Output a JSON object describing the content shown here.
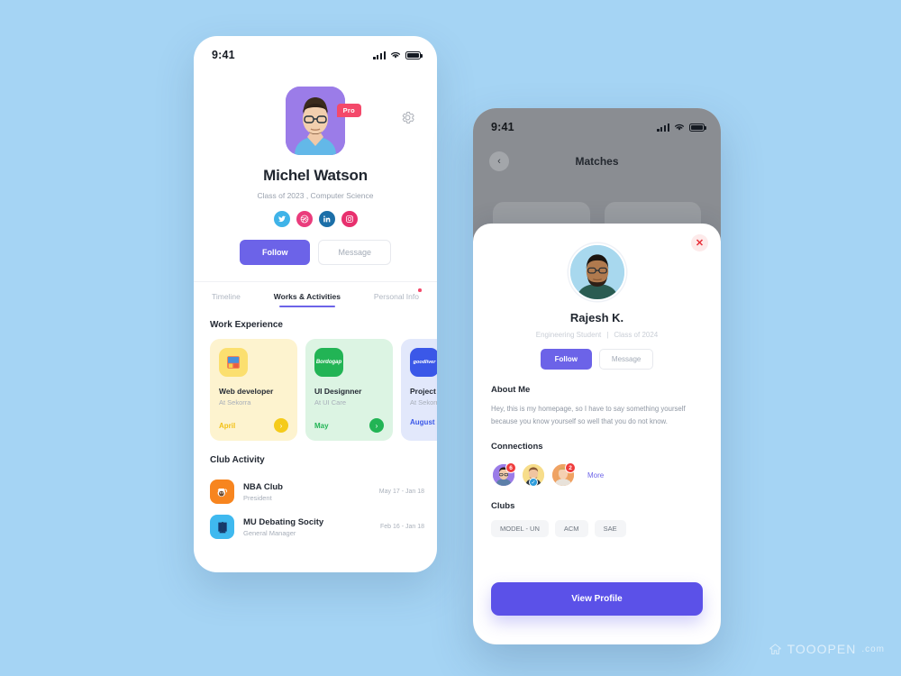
{
  "background_color": "#a5d4f4",
  "accent_color": "#6c63e8",
  "phone1": {
    "status_bar": {
      "time": "9:41",
      "signal_icon": "signal-bars-icon",
      "wifi_icon": "wifi-icon",
      "battery_icon": "battery-icon"
    },
    "settings_icon": "gear-icon",
    "avatar": "user-avatar-michel",
    "pro_badge": "Pro",
    "name": "Michel Watson",
    "subtitle": "Class of 2023 , Computer Science",
    "socials": [
      {
        "name": "twitter-icon",
        "color": "#3fb3e8"
      },
      {
        "name": "dribbble-icon",
        "color": "#ea3c7c"
      },
      {
        "name": "linkedin-icon",
        "color": "#1c6fa8"
      },
      {
        "name": "instagram-icon",
        "color": "#e8306e"
      }
    ],
    "follow_label": "Follow",
    "message_label": "Message",
    "tabs": [
      {
        "label": "Timeline",
        "active": false,
        "dot": false
      },
      {
        "label": "Works & Activities",
        "active": true,
        "dot": false
      },
      {
        "label": "Personal Info",
        "active": false,
        "dot": true
      }
    ],
    "work_section_title": "Work Experience",
    "work_cards": [
      {
        "title": "Web developer",
        "company": "At Sekorra",
        "month": "April",
        "bg": "#fdf3cf",
        "icon_bg": "#fbdf6f",
        "accent": "#f2c014",
        "logo_text": ""
      },
      {
        "title": "UI Designner",
        "company": "At UI Care",
        "month": "May",
        "bg": "#dcf4e3",
        "icon_bg": "#22b455",
        "accent": "#22b455",
        "logo_text": "Bordogap"
      },
      {
        "title": "Project Man",
        "company": "At Sekorra",
        "month": "August",
        "bg": "#e2e8fb",
        "icon_bg": "#3b58e8",
        "accent": "#3b58e8",
        "logo_text": "goodliver"
      }
    ],
    "club_section_title": "Club Activity",
    "clubs": [
      {
        "name": "NBA Club",
        "role": "President",
        "date": "May 17 - Jan 18",
        "icon_bg": "#f7851f",
        "icon": "mascot-icon"
      },
      {
        "name": "MU Debating Socity",
        "role": "General Manager",
        "date": "Feb 16 - Jan 18",
        "icon_bg": "#3fb9ef",
        "icon": "book-icon"
      }
    ]
  },
  "phone2": {
    "status_bar": {
      "time": "9:41",
      "signal_icon": "signal-bars-icon",
      "wifi_icon": "wifi-icon",
      "battery_icon": "battery-icon"
    },
    "back_icon": "chevron-left-icon",
    "header_title": "Matches",
    "close_icon": "close-x-icon",
    "avatar": "user-avatar-rajesh",
    "name": "Rajesh K.",
    "subtitle_left": "Engineering Student",
    "subtitle_right": "Class of 2024",
    "follow_label": "Follow",
    "message_label": "Message",
    "about_title": "About Me",
    "about_text": "Hey, this is my homepage, so I have to say something yourself because you know yourself so well that you do not know.",
    "connections_title": "Connections",
    "connections": [
      {
        "name": "connection-avatar-1",
        "badge": "6",
        "verified": false,
        "bg": "#9b7ce8"
      },
      {
        "name": "connection-avatar-2",
        "badge": "",
        "verified": true,
        "bg": "#f7dd8a"
      },
      {
        "name": "connection-avatar-3",
        "badge": "2",
        "verified": false,
        "bg": "#f0a263"
      }
    ],
    "more_label": "More",
    "clubs_title": "Clubs",
    "club_chips": [
      "MODEL - UN",
      "ACM",
      "SAE"
    ],
    "view_profile_label": "View Profile"
  },
  "watermark": {
    "brand": "TOOOPEN",
    "suffix": ".com",
    "icon": "logo-icon"
  }
}
